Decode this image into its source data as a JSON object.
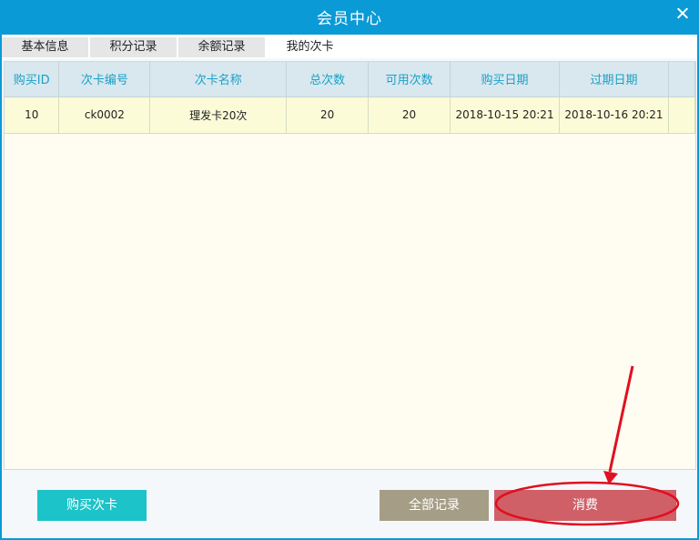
{
  "window": {
    "title": "会员中心"
  },
  "tabs": [
    {
      "label": "基本信息"
    },
    {
      "label": "积分记录"
    },
    {
      "label": "余额记录"
    },
    {
      "label": "我的次卡"
    }
  ],
  "table": {
    "columns": [
      "购买ID",
      "次卡编号",
      "次卡名称",
      "总次数",
      "可用次数",
      "购买日期",
      "过期日期"
    ],
    "rows": [
      [
        "10",
        "ck0002",
        "理发卡20次",
        "20",
        "20",
        "2018-10-15 20:21",
        "2018-10-16 20:21"
      ]
    ]
  },
  "buttons": {
    "buy_card": "购买次卡",
    "all_records": "全部记录",
    "consume": "消费"
  },
  "colors": {
    "title_bar": "#0a9ad6",
    "buy_button": "#1cc3c8",
    "records_button": "#a59d86",
    "consume_button": "#cf6068",
    "annotation": "#e01020"
  }
}
